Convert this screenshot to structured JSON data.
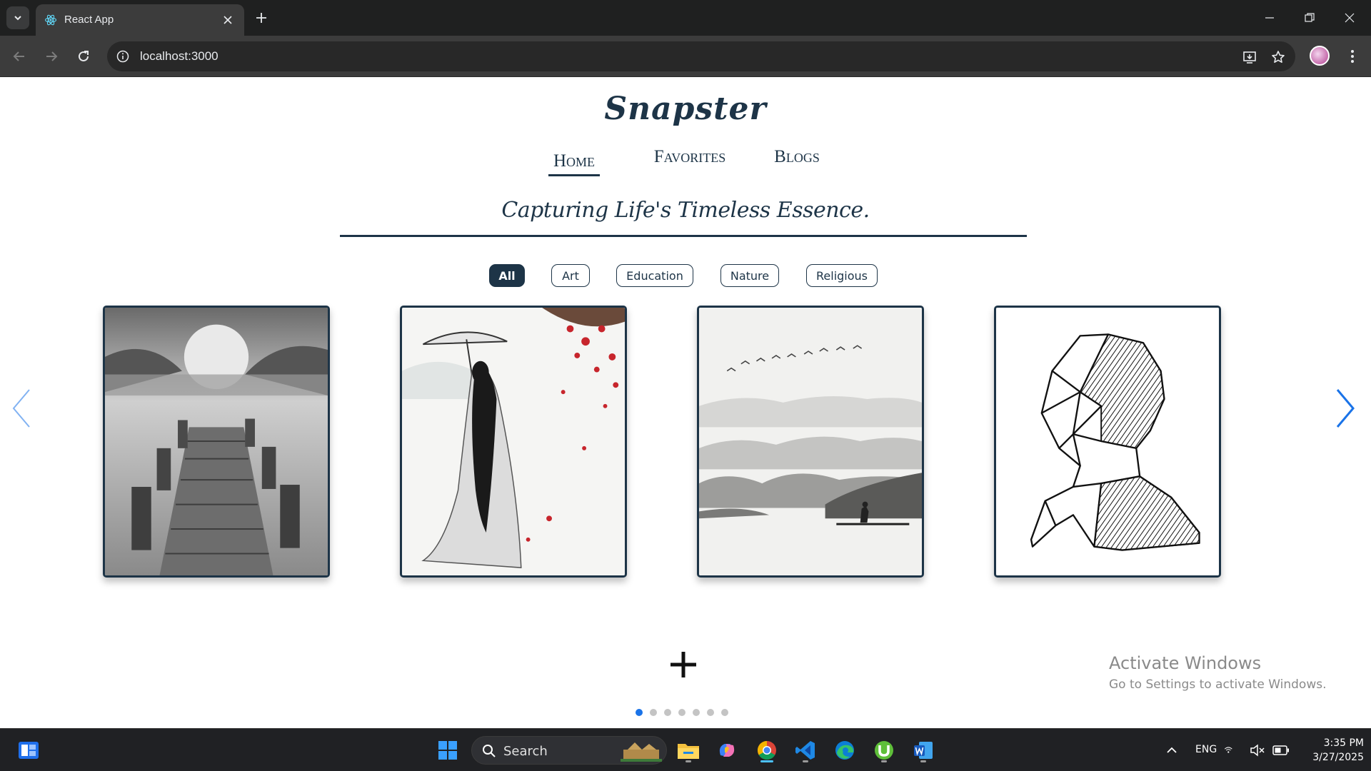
{
  "browser": {
    "tab_title": "React App",
    "url": "localhost:3000",
    "icons": [
      "tab-search-chevron-icon",
      "react-favicon-icon",
      "close-tab-icon",
      "new-tab-icon",
      "minimize-icon",
      "restore-icon",
      "close-window-icon",
      "back-icon",
      "forward-icon",
      "reload-icon",
      "site-info-icon",
      "install-app-icon",
      "bookmark-star-icon",
      "profile-avatar",
      "menu-kebab-icon"
    ]
  },
  "site": {
    "logo": "Snapster",
    "nav": [
      {
        "label": "Home",
        "active": true
      },
      {
        "label": "Favorites",
        "active": false
      },
      {
        "label": "Blogs",
        "active": false
      }
    ],
    "tagline": "Capturing Life's Timeless Essence.",
    "accent_color": "#1d3447"
  },
  "filters": [
    {
      "label": "All",
      "active": true
    },
    {
      "label": "Art",
      "active": false
    },
    {
      "label": "Education",
      "active": false
    },
    {
      "label": "Nature",
      "active": false
    },
    {
      "label": "Religious",
      "active": false
    }
  ],
  "carousel": {
    "cards": [
      {
        "subject": "pencil sketch of a wooden pier over a lake at sunset"
      },
      {
        "subject": "ink painting of a woman with an umbrella under red blossoms"
      },
      {
        "subject": "misty mountains with a lone boatman and flying birds"
      },
      {
        "subject": "geometric line-art portrait of a human head"
      }
    ],
    "page_count": 7,
    "current_page": 1,
    "arrow_color": "#1a73e8",
    "add_label": "+"
  },
  "watermark": {
    "title": "Activate Windows",
    "subtitle": "Go to Settings to activate Windows."
  },
  "taskbar": {
    "search_label": "Search",
    "language": "ENG",
    "time": "3:35 PM",
    "date": "3/27/2025",
    "icons": [
      "widgets-icon",
      "windows-start-icon",
      "search-icon",
      "file-explorer-icon",
      "copilot-icon",
      "chrome-icon",
      "vscode-icon",
      "edge-icon",
      "utorrent-icon",
      "word-icon",
      "tray-chevron-icon",
      "wifi-icon",
      "speaker-muted-icon",
      "battery-icon"
    ]
  }
}
